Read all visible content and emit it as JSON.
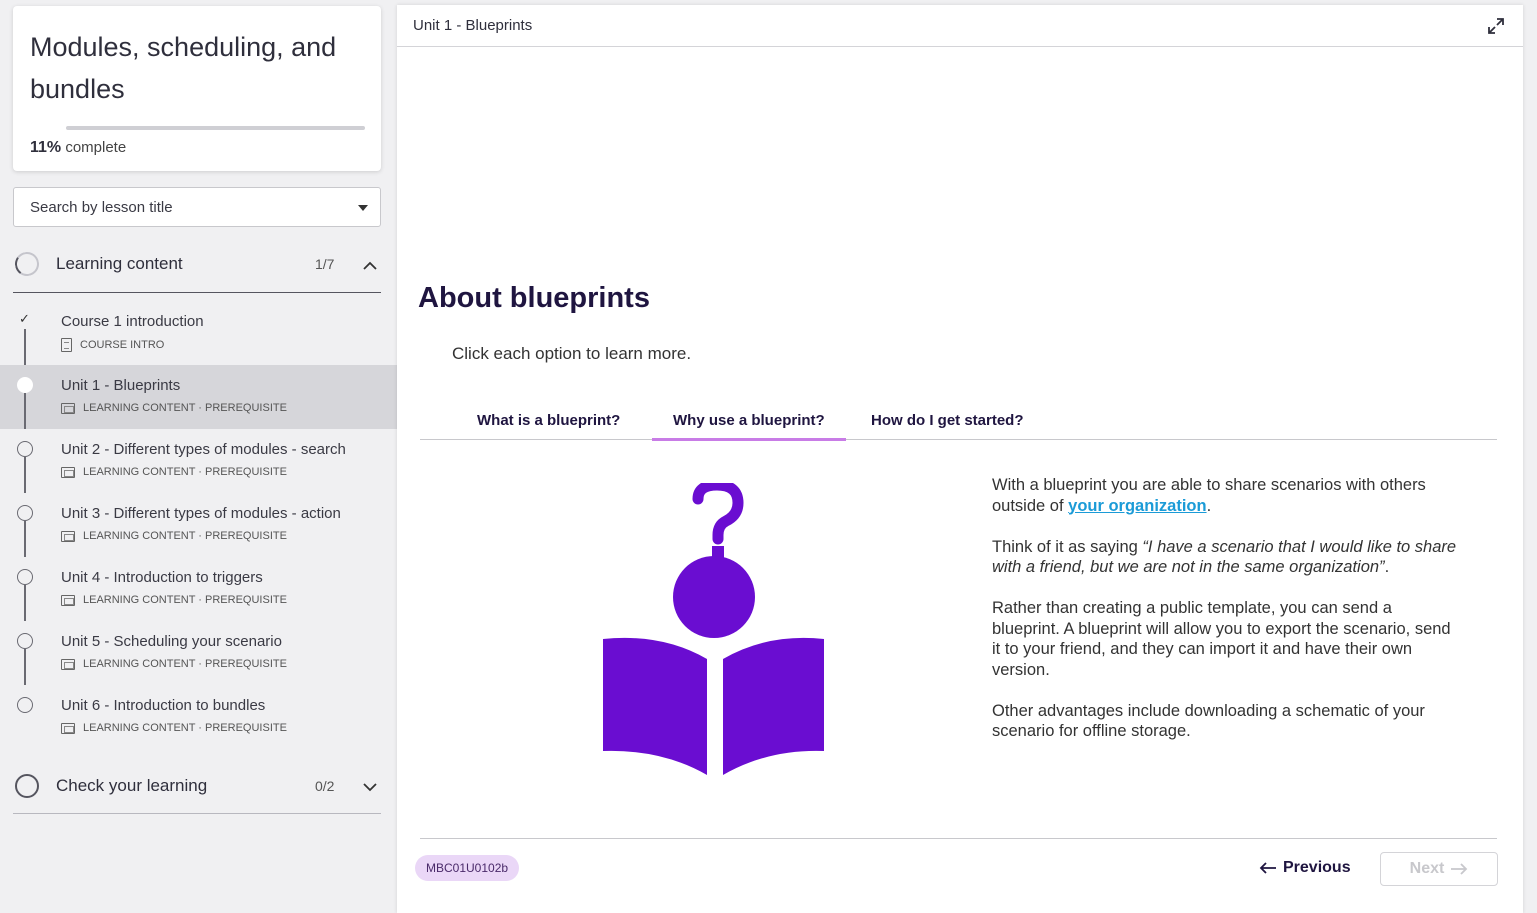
{
  "course": {
    "title": "Modules, scheduling, and bundles",
    "progress_value": "11%",
    "progress_suffix": "complete",
    "progress_fraction": 0.0
  },
  "search": {
    "placeholder": "Search by lesson title"
  },
  "sections": [
    {
      "label": "Learning content",
      "count": "1/7",
      "expanded": true
    },
    {
      "label": "Check your learning",
      "count": "0/2",
      "expanded": false
    }
  ],
  "lessons": [
    {
      "title": "Course 1 introduction",
      "meta": "COURSE INTRO",
      "status": "complete"
    },
    {
      "title": "Unit 1 - Blueprints",
      "meta": "LEARNING CONTENT · PREREQUISITE",
      "status": "current"
    },
    {
      "title": "Unit 2 - Different types of modules - search",
      "meta": "LEARNING CONTENT · PREREQUISITE",
      "status": "not-started"
    },
    {
      "title": "Unit 3 - Different types of modules - action",
      "meta": "LEARNING CONTENT · PREREQUISITE",
      "status": "not-started"
    },
    {
      "title": "Unit 4 - Introduction to triggers",
      "meta": "LEARNING CONTENT · PREREQUISITE",
      "status": "not-started"
    },
    {
      "title": "Unit 5 - Scheduling your scenario",
      "meta": "LEARNING CONTENT · PREREQUISITE",
      "status": "not-started"
    },
    {
      "title": "Unit 6 - Introduction to bundles",
      "meta": "LEARNING CONTENT · PREREQUISITE",
      "status": "not-started"
    }
  ],
  "main": {
    "breadcrumb": "Unit 1 - Blueprints",
    "heading": "About blueprints",
    "instruction": "Click each option to learn more.",
    "tabs": [
      {
        "label": "What is a blueprint?",
        "active": false
      },
      {
        "label": "Why use a blueprint?",
        "active": true
      },
      {
        "label": "How do I get started?",
        "active": false
      }
    ],
    "body": {
      "p1_before": "With a blueprint you are able to share scenarios with others outside of ",
      "p1_link": "your organization",
      "p1_after": ".",
      "p2_before": "Think of it as saying ",
      "p2_quote": "“I have a scenario that I would like to share with a friend, but we are not in the same organization”",
      "p2_after": ".",
      "p3": "Rather than creating a public template, you can send a blueprint. A blueprint will allow you to export the scenario, send it to your friend, and they can import it and have their own version.",
      "p4": "Other advantages include downloading a schematic of your scenario for offline storage."
    },
    "footer": {
      "code": "MBC01U0102b",
      "previous_label": "Previous",
      "next_label": "Next"
    }
  },
  "colors": {
    "accent_purple": "#6a0dd1",
    "tab_underline": "#c87ce6",
    "link": "#1b9bd7",
    "heading": "#1f1540"
  },
  "icons": [
    "chevron-up-icon",
    "chevron-down-icon",
    "checkmark-icon",
    "lesson-screen-icon",
    "document-icon",
    "expand-icon",
    "arrow-left-icon",
    "arrow-right-icon",
    "dropdown-caret-icon"
  ]
}
